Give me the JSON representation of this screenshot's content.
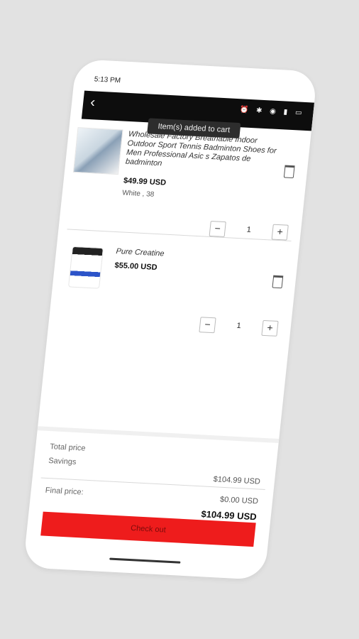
{
  "status": {
    "time": "5:13 PM"
  },
  "toast": "Item(s) added to cart",
  "items": [
    {
      "title": "Wholesale Factory Breathable Indoor Outdoor Sport Tennis Badminton Shoes for Men Professional Asic s Zapatos de badminton",
      "price": "$49.99 USD",
      "variant": "White , 38",
      "quantity": "1",
      "icon": "shoe-image"
    },
    {
      "title": "Pure Creatine",
      "price": "$55.00 USD",
      "variant": "",
      "quantity": "1",
      "icon": "creatine-can-image"
    }
  ],
  "summary": {
    "total_label": "Total price",
    "savings_label": "Savings",
    "final_label": "Final price:",
    "total_value": "$104.99 USD",
    "savings_value": "$0.00 USD",
    "final_value": "$104.99 USD"
  },
  "checkout_label": "Check out",
  "qty_minus": "−",
  "qty_plus": "+"
}
